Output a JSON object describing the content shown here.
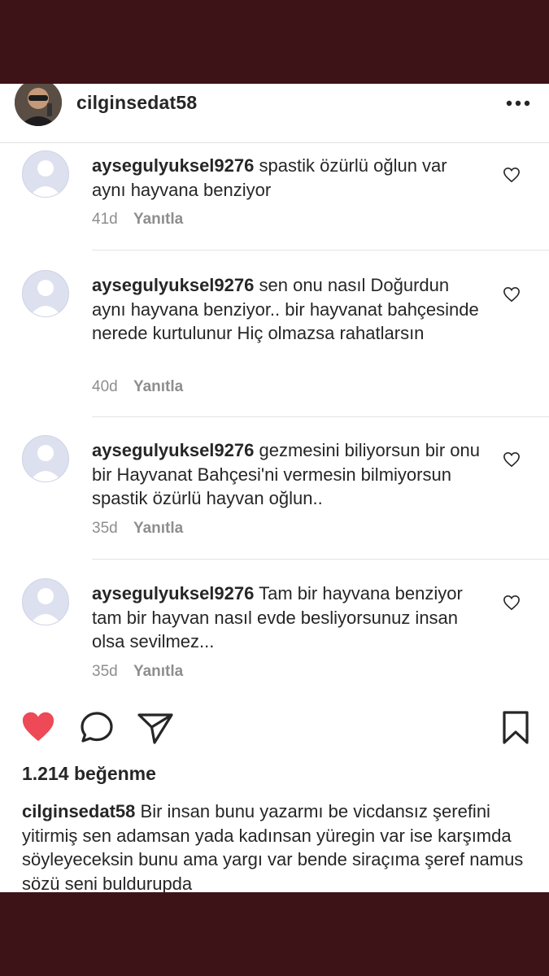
{
  "post": {
    "username": "cilginsedat58",
    "likes_text": "1.214 beğenme",
    "caption": "Bir insan bunu yazarmı be vicdansız şerefini yitirmiş sen adamsan yada kadınsan yüregin var ise karşımda söyleyeceksin bunu ama yargı var bende siraçıma şeref namus sözü seni buldurupda"
  },
  "comments": [
    {
      "username": "aysegulyuksel9276",
      "text": "spastik özürlü  oğlun var  aynı hayvana  benziyor",
      "time": "41d",
      "reply_label": "Yanıtla"
    },
    {
      "username": "aysegulyuksel9276",
      "text": "sen onu nasıl Doğurdun aynı hayvana benziyor.. bir hayvanat bahçesinde nerede kurtulunur Hiç olmazsa rahatlarsın",
      "time": "40d",
      "reply_label": "Yanıtla"
    },
    {
      "username": "aysegulyuksel9276",
      "text": "gezmesini biliyorsun bir onu bir Hayvanat Bahçesi'ni vermesin bilmiyorsun  spastik  özürlü  hayvan oğlun..",
      "time": "35d",
      "reply_label": "Yanıtla"
    },
    {
      "username": "aysegulyuksel9276",
      "text": "Tam bir hayvana benziyor tam bir hayvan nasıl evde besliyorsunuz insan olsa sevilmez...",
      "time": "35d",
      "reply_label": "Yanıtla"
    }
  ],
  "icons": {
    "more": "more-options-icon",
    "like": "heart-filled-icon",
    "comment": "comment-bubble-icon",
    "share": "paper-plane-icon",
    "save": "bookmark-icon",
    "comment_like": "heart-outline-icon"
  },
  "colors": {
    "like_red": "#ed4956",
    "frame": "#3e1317",
    "meta_gray": "#8e8e8e"
  }
}
